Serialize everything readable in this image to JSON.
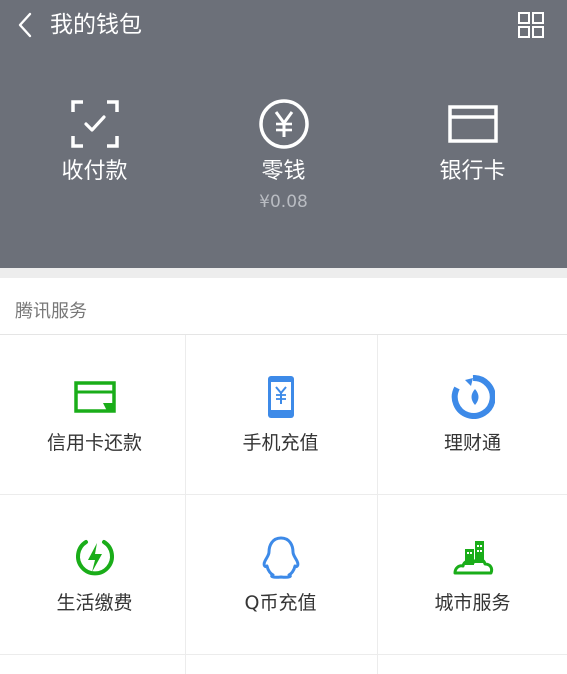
{
  "header": {
    "title": "我的钱包",
    "bg_color": "#6c7079",
    "back_icon": "chevron-left-icon",
    "more_icon": "grid-icon"
  },
  "actions": [
    {
      "label": "收付款",
      "icon": "scan-check-icon"
    },
    {
      "label": "零钱",
      "sub": "¥0.08",
      "icon": "yen-circle-icon"
    },
    {
      "label": "银行卡",
      "icon": "card-icon"
    }
  ],
  "services": {
    "title": "腾讯服务",
    "items": [
      {
        "label": "信用卡还款",
        "icon": "credit-card-repay-icon",
        "color": "#1aad19"
      },
      {
        "label": "手机充值",
        "icon": "phone-topup-icon",
        "color": "#3d8ae8"
      },
      {
        "label": "理财通",
        "icon": "wealth-icon",
        "color": "#3d8ae8"
      },
      {
        "label": "生活缴费",
        "icon": "bolt-icon",
        "color": "#1aad19"
      },
      {
        "label": "Q币充值",
        "icon": "penguin-icon",
        "color": "#3d8ae8"
      },
      {
        "label": "城市服务",
        "icon": "city-icon",
        "color": "#1aad19"
      }
    ]
  }
}
